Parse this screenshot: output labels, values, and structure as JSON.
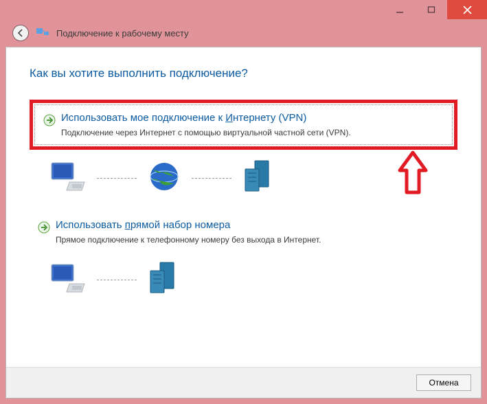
{
  "titlebar": {},
  "header": {
    "title": "Подключение к рабочему месту"
  },
  "heading": "Как вы хотите выполнить подключение?",
  "option1": {
    "title_pre": "Использовать мое подключение к ",
    "title_u": "И",
    "title_post": "нтернету (VPN)",
    "subtitle": "Подключение через Интернет с помощью виртуальной частной сети (VPN)."
  },
  "option2": {
    "title_pre": "Использовать ",
    "title_u": "п",
    "title_post": "рямой набор номера",
    "subtitle": "Прямое подключение к телефонному номеру без выхода в Интернет."
  },
  "footer": {
    "cancel": "Отмена"
  }
}
